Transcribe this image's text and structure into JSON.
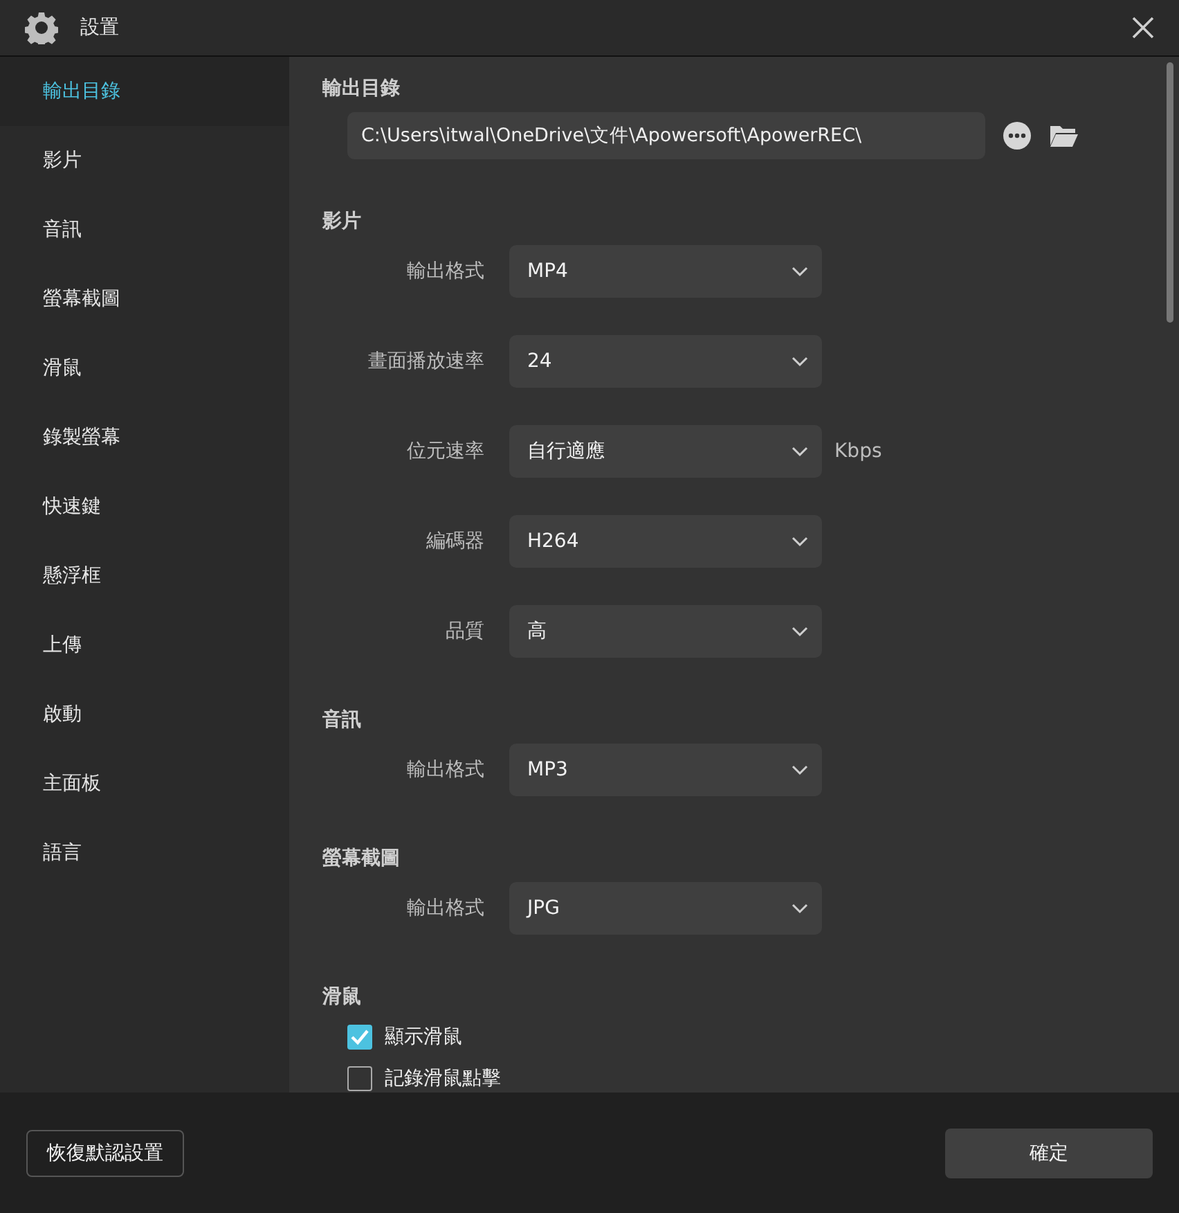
{
  "window": {
    "title": "設置"
  },
  "sidebar": {
    "items": [
      {
        "label": "輸出目錄",
        "selected": true
      },
      {
        "label": "影片",
        "selected": false
      },
      {
        "label": "音訊",
        "selected": false
      },
      {
        "label": "螢幕截圖",
        "selected": false
      },
      {
        "label": "滑鼠",
        "selected": false
      },
      {
        "label": "錄製螢幕",
        "selected": false
      },
      {
        "label": "快速鍵",
        "selected": false
      },
      {
        "label": "懸浮框",
        "selected": false
      },
      {
        "label": "上傳",
        "selected": false
      },
      {
        "label": "啟動",
        "selected": false
      },
      {
        "label": "主面板",
        "selected": false
      },
      {
        "label": "語言",
        "selected": false
      }
    ]
  },
  "output_directory": {
    "title": "輸出目錄",
    "path": "C:\\Users\\itwal\\OneDrive\\文件\\Apowersoft\\ApowerREC\\"
  },
  "sections": [
    {
      "title": "影片",
      "rows": [
        {
          "kind": "select",
          "label": "輸出格式",
          "value": "MP4"
        },
        {
          "kind": "select",
          "label": "畫面播放速率",
          "value": "24"
        },
        {
          "kind": "select",
          "label": "位元速率",
          "value": "自行適應",
          "unit": "Kbps"
        },
        {
          "kind": "select",
          "label": "編碼器",
          "value": "H264"
        },
        {
          "kind": "select",
          "label": "品質",
          "value": "高"
        }
      ]
    },
    {
      "title": "音訊",
      "rows": [
        {
          "kind": "select",
          "label": "輸出格式",
          "value": "MP3"
        }
      ]
    },
    {
      "title": "螢幕截圖",
      "rows": [
        {
          "kind": "select",
          "label": "輸出格式",
          "value": "JPG"
        }
      ]
    },
    {
      "title": "滑鼠",
      "rows": [
        {
          "kind": "checkbox",
          "label": "顯示滑鼠",
          "checked": true
        },
        {
          "kind": "checkbox",
          "label": "記錄滑鼠點擊",
          "checked": false
        }
      ]
    }
  ],
  "footer": {
    "reset_button": "恢復默認設置",
    "confirm_button": "確定"
  }
}
